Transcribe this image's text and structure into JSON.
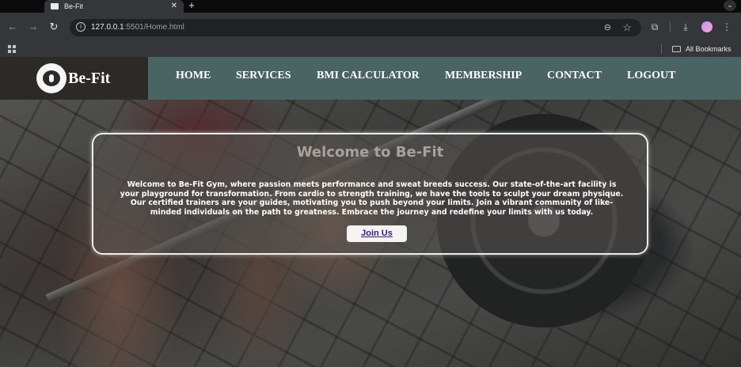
{
  "browser": {
    "tab_title": "Be-Fit",
    "tab_close": "✕",
    "new_tab": "+",
    "tab_menu": "⌄",
    "back": "←",
    "forward": "→",
    "reload": "↻",
    "url_host": "127.0.0.1",
    "url_path": ":5501/Home.html",
    "zoom": "⊖",
    "bookmark_star": "☆",
    "bookmarks_label": "All Bookmarks",
    "icons": {
      "extensions": "⧉",
      "download": "⤓",
      "menu": "⋮"
    }
  },
  "site": {
    "brand": "Be-Fit",
    "nav": [
      {
        "label": "HOME"
      },
      {
        "label": "SERVICES"
      },
      {
        "label": "BMI CALCULATOR"
      },
      {
        "label": "MEMBERSHIP"
      },
      {
        "label": "CONTACT"
      },
      {
        "label": "LOGOUT"
      }
    ],
    "welcome": {
      "title": "Welcome to Be-Fit",
      "body": "Welcome to Be-Fit Gym, where passion meets performance and sweat breeds success. Our state-of-the-art facility is your playground for transformation. From cardio to strength training, we have the tools to sculpt your dream physique. Our certified trainers are your guides, motivating you to push beyond your limits. Join a vibrant community of like-minded individuals on the path to greatness. Embrace the journey and redefine your limits with us today.",
      "button": "Join Us"
    },
    "colors": {
      "nav_bg": "#4a6463",
      "logo_bg": "#2b2a27",
      "button_text": "#3c1a78"
    }
  }
}
